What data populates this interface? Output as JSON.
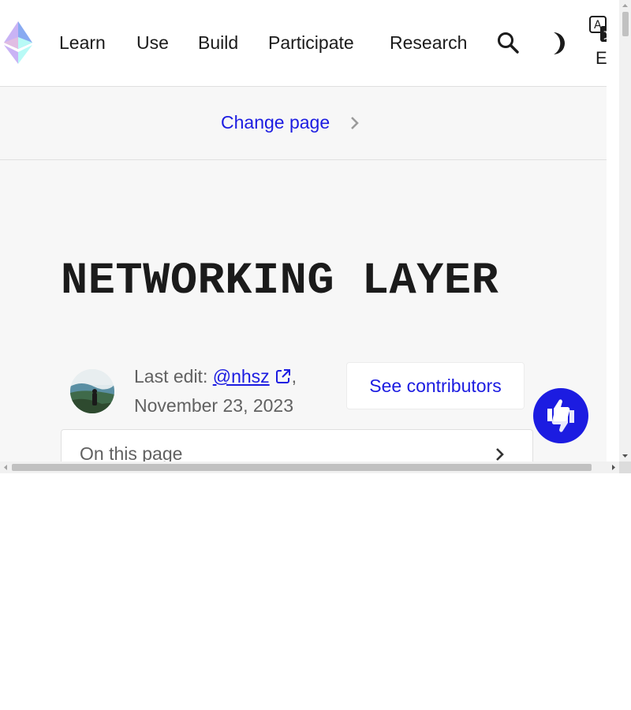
{
  "header": {
    "logo": "ethereum-logo",
    "nav": [
      "Learn",
      "Use",
      "Build",
      "Participate",
      "Research"
    ],
    "language": "EN",
    "icons": [
      "search-icon",
      "moon-icon",
      "translate-icon"
    ]
  },
  "change_page": {
    "label": "Change page"
  },
  "page": {
    "title": "NETWORKING LAYER",
    "last_edit_label": "Last edit:",
    "last_edit_author": "@nhsz",
    "last_edit_date": "November 23, 2023",
    "contributors_label": "See contributors",
    "toc_label": "On this page"
  },
  "colors": {
    "accent": "#1c1ce1",
    "background": "#f7f7f7",
    "text": "#1b1b1b",
    "muted": "#616161"
  }
}
